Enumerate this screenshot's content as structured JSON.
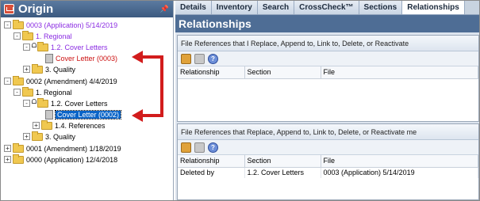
{
  "left_panel": {
    "title": "Origin",
    "pin_glyph": "📌",
    "tree": [
      {
        "label": "0003 (Application) 5/14/2019",
        "color": "purple",
        "kind": "folder",
        "expander": "-"
      },
      {
        "label": "1. Regional",
        "color": "purple",
        "kind": "folder",
        "expander": "-"
      },
      {
        "label": "1.2. Cover Letters",
        "color": "purple",
        "kind": "folder-lock",
        "expander": "-"
      },
      {
        "label": "Cover Letter (0003)",
        "color": "red",
        "kind": "doc",
        "expander": ""
      },
      {
        "label": "3. Quality",
        "color": "black",
        "kind": "folder",
        "expander": "+"
      },
      {
        "label": "0002 (Amendment) 4/4/2019",
        "color": "black",
        "kind": "folder",
        "expander": "-"
      },
      {
        "label": "1. Regional",
        "color": "black",
        "kind": "folder",
        "expander": "-"
      },
      {
        "label": "1.2. Cover Letters",
        "color": "black",
        "kind": "folder-lock",
        "expander": "-"
      },
      {
        "label": "Cover Letter (0002)",
        "color": "selected",
        "kind": "doc",
        "expander": ""
      },
      {
        "label": "1.4. References",
        "color": "black",
        "kind": "folder",
        "expander": "+"
      },
      {
        "label": "3. Quality",
        "color": "black",
        "kind": "folder",
        "expander": "+"
      },
      {
        "label": "0001 (Amendment) 1/18/2019",
        "color": "black",
        "kind": "folder",
        "expander": "+"
      },
      {
        "label": "0000 (Application) 12/4/2018",
        "color": "black",
        "kind": "folder",
        "expander": "+"
      }
    ]
  },
  "right_panel": {
    "tabs": [
      "Details",
      "Inventory",
      "Search",
      "CrossCheck™",
      "Sections",
      "Relationships"
    ],
    "active_tab": "Relationships",
    "header": "Relationships",
    "section1": {
      "title": "File References that I Replace, Append to, Link to, Delete, or Reactivate",
      "columns": [
        "Relationship",
        "Section",
        "File"
      ],
      "rows": []
    },
    "section2": {
      "title": "File References that Replace, Append to, Link to, Delete, or Reactivate me",
      "columns": [
        "Relationship",
        "Section",
        "File"
      ],
      "rows": [
        [
          "Deleted by",
          "1.2. Cover Letters",
          "0003 (Application) 5/14/2019"
        ]
      ]
    },
    "help_glyph": "?"
  },
  "colors": {
    "purple": "#8a2be2",
    "red": "#cc1111",
    "selection": "#0a64c8",
    "arrow": "#d21c1c",
    "header": "#4e6d95"
  }
}
